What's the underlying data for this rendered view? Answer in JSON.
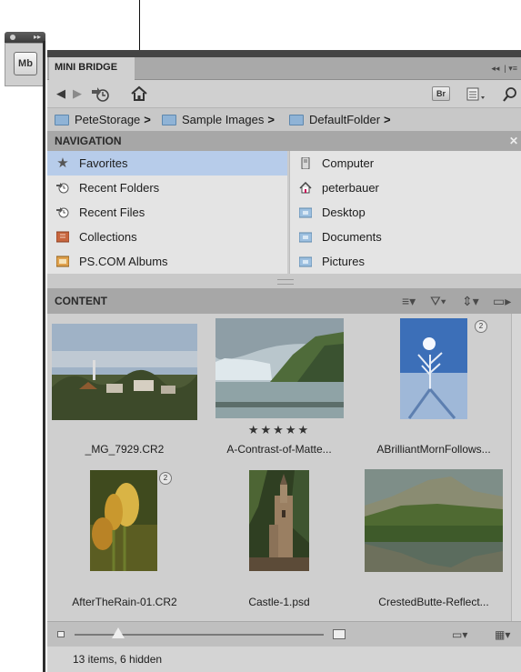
{
  "dock": {
    "icon_label": "Mb"
  },
  "panel": {
    "tab_label": "MINI BRIDGE",
    "toolbar": {
      "bridge_button_label": "Br"
    },
    "breadcrumbs": [
      "PeteStorage",
      "Sample Images",
      "DefaultFolder"
    ],
    "breadcrumb_separator": ">"
  },
  "navigation": {
    "header": "NAVIGATION",
    "left_items": [
      {
        "label": "Favorites",
        "icon": "star-icon",
        "selected": true
      },
      {
        "label": "Recent Folders",
        "icon": "recent-folders-icon"
      },
      {
        "label": "Recent Files",
        "icon": "recent-files-icon"
      },
      {
        "label": "Collections",
        "icon": "collections-icon"
      },
      {
        "label": "PS.COM Albums",
        "icon": "albums-icon"
      }
    ],
    "right_items": [
      {
        "label": "Computer",
        "icon": "computer-icon"
      },
      {
        "label": "peterbauer",
        "icon": "home-icon"
      },
      {
        "label": "Desktop",
        "icon": "folder-icon"
      },
      {
        "label": "Documents",
        "icon": "folder-icon"
      },
      {
        "label": "Pictures",
        "icon": "folder-icon"
      }
    ]
  },
  "content": {
    "header": "CONTENT",
    "items": [
      {
        "caption": "_MG_7929.CR2",
        "rating": ""
      },
      {
        "caption": "A-Contrast-of-Matte...",
        "rating": "★★★★★"
      },
      {
        "caption": "ABrilliantMornFollows...",
        "rating": "",
        "stacked": true
      },
      {
        "caption": "AfterTheRain-01.CR2",
        "rating": "",
        "stacked": true
      },
      {
        "caption": "Castle-1.psd",
        "rating": ""
      },
      {
        "caption": "CrestedButte-Reflect...",
        "rating": ""
      }
    ]
  },
  "status": {
    "text": "13 items, 6 hidden"
  },
  "colors": {
    "selection": "#b7ccea",
    "panel_bg": "#cbcbcb",
    "header_bg": "#a7a7a7"
  }
}
